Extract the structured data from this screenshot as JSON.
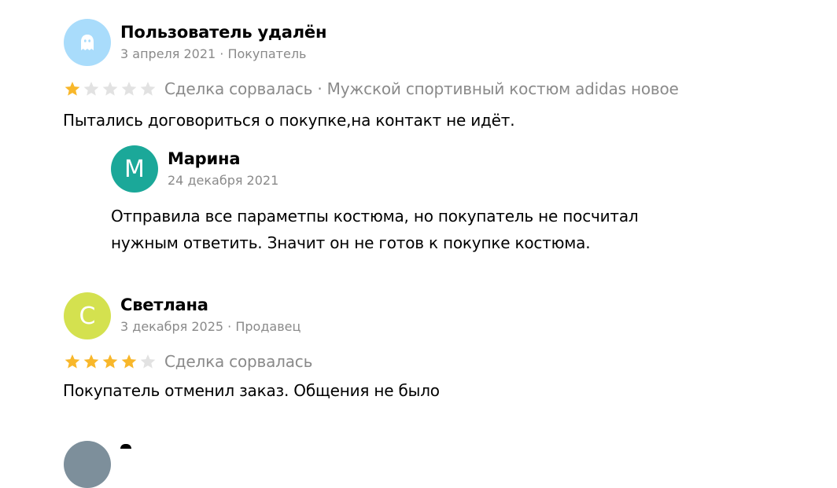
{
  "reviews": [
    {
      "author": "Пользователь удалён",
      "meta": "3 апреля 2021 · Покупатель",
      "avatar_color": "#a9dcfb",
      "avatar_icon": "ghost-icon",
      "rating": 1,
      "deal": "Сделка сорвалась · Мужской спортивный костюм adidas новое",
      "text": "Пытались договориться о покупке,на контакт не идёт.",
      "reply": {
        "author": "Марина",
        "meta": "24 декабря 2021",
        "avatar_letter": "М",
        "avatar_color": "#1ba899",
        "text_lines": [
          "Отправила все параметпы костюма, но покупатель не посчитал",
          "нужным ответить. Значит он не готов к покупке костюма."
        ]
      }
    },
    {
      "author": "Светлана",
      "meta": "3 декабря 2025 · Продавец",
      "avatar_letter": "С",
      "avatar_color": "#d4e14f",
      "rating": 4,
      "deal": "Сделка сорвалась",
      "text": "Покупатель отменил заказ. Общения не было"
    },
    {
      "avatar_color": "#7d8f9b"
    }
  ],
  "colors": {
    "star_filled": "#f8b72a",
    "star_empty": "#e2e2e2",
    "secondary_text": "#8a8a8a"
  }
}
